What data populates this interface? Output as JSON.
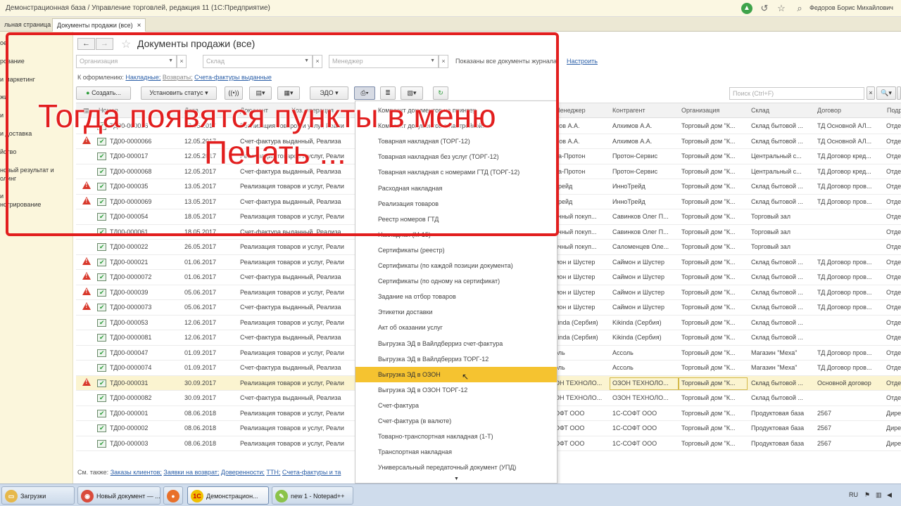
{
  "app": {
    "title": "Демонстрационная база / Управление торговлей, редакция 11  (1С:Предприятие)",
    "user": "Федоров Борис Михайлович"
  },
  "tabs": [
    {
      "label": "льная страница"
    },
    {
      "label": "Документы продажи (все)"
    }
  ],
  "sidebar": [
    "ое",
    "рование",
    "и маркетинг",
    "жи",
    "и",
    "и доставка",
    "йство",
    "новый результат и",
    "олинг",
    "и",
    "нстрирование"
  ],
  "form": {
    "title": "Документы продажи (все)",
    "filters": {
      "organization_placeholder": "Организация",
      "warehouse_placeholder": "Склад",
      "manager_placeholder": "Менеджер"
    },
    "shown_text": "Показаны все документы журнала",
    "setup_link": "Настроить",
    "to_form_label": "К оформлению:",
    "to_form_links": [
      "Накладные;",
      "Возвраты;",
      "Счета-фактуры выданные"
    ],
    "toolbar": {
      "create": "Создать...",
      "set_status": "Установить статус",
      "edo": "ЭДО"
    },
    "search_placeholder": "Поиск (Ctrl+F)"
  },
  "table": {
    "headers": [
      "Номер",
      "Дата",
      "Документ",
      "Хоз. операция",
      "Менеджер",
      "Контрагент",
      "Организация",
      "Склад",
      "Договор",
      "Подр"
    ],
    "rows": [
      {
        "warn": false,
        "num": "ТД00-000016",
        "date": "12.05.2017",
        "doc": "Реализация товаров и услуг, Реали",
        "mgr": "мов А.А.",
        "contr": "Алхимов А.А.",
        "org": "Торговый дом \"К...",
        "wh": "Склад бытовой ...",
        "contract": "ТД Основной АЛ...",
        "dep": "Отде"
      },
      {
        "warn": true,
        "num": "ТД00-0000066",
        "date": "12.05.2017",
        "doc": "Счет-фактура выданный, Реализа",
        "mgr": "мов А.А.",
        "contr": "Алхимов А.А.",
        "org": "Торговый дом \"К...",
        "wh": "Склад бытовой ...",
        "contract": "ТД Основной АЛ...",
        "dep": "Отде"
      },
      {
        "warn": false,
        "num": "ТД00-000017",
        "date": "12.05.2017",
        "doc": "Реализация товаров и услуг, Реали",
        "mgr": "ра-Протон",
        "contr": "Протон-Сервис",
        "org": "Торговый дом \"К...",
        "wh": "Центральный с...",
        "contract": "ТД Договор кред...",
        "dep": "Отде"
      },
      {
        "warn": false,
        "num": "ТД00-0000068",
        "date": "12.05.2017",
        "doc": "Счет-фактура выданный, Реализа",
        "mgr": "ра-Протон",
        "contr": "Протон-Сервис",
        "org": "Торговый дом \"К...",
        "wh": "Центральный с...",
        "contract": "ТД Договор кред...",
        "dep": "Отде"
      },
      {
        "warn": true,
        "num": "ТД00-000035",
        "date": "13.05.2017",
        "doc": "Реализация товаров и услуг, Реали",
        "mgr": "Трейд",
        "contr": "ИнноТрейд",
        "org": "Торговый дом \"К...",
        "wh": "Склад бытовой ...",
        "contract": "ТД Договор пров...",
        "dep": "Отде"
      },
      {
        "warn": true,
        "num": "ТД00-0000069",
        "date": "13.05.2017",
        "doc": "Счет-фактура выданный, Реализа",
        "mgr": "Трейд",
        "contr": "ИнноТрейд",
        "org": "Торговый дом \"К...",
        "wh": "Склад бытовой ...",
        "contract": "ТД Договор пров...",
        "dep": "Отде"
      },
      {
        "warn": false,
        "num": "ТД00-000054",
        "date": "18.05.2017",
        "doc": "Реализация товаров и услуг, Реали",
        "mgr": "ичный покуп...",
        "contr": "Савинков Олег П...",
        "org": "Торговый дом \"К...",
        "wh": "Торговый зал",
        "contract": "",
        "dep": "Отде"
      },
      {
        "warn": false,
        "num": "ТД00-000061",
        "date": "18.05.2017",
        "doc": "Счет-фактура выданный, Реализа",
        "mgr": "ичный покуп...",
        "contr": "Савинков Олег П...",
        "org": "Торговый дом \"К...",
        "wh": "Торговый зал",
        "contract": "",
        "dep": "Отде"
      },
      {
        "warn": false,
        "num": "ТД00-000022",
        "date": "26.05.2017",
        "doc": "Реализация товаров и услуг, Реали",
        "mgr": "ичный покуп...",
        "contr": "Саломенцев Оле...",
        "org": "Торговый дом \"К...",
        "wh": "Торговый зал",
        "contract": "",
        "dep": "Отде"
      },
      {
        "warn": true,
        "num": "ТД00-000021",
        "date": "01.06.2017",
        "doc": "Реализация товаров и услуг, Реали",
        "mgr": "мон и Шустер",
        "contr": "Саймон и Шустер",
        "org": "Торговый дом \"К...",
        "wh": "Склад бытовой ...",
        "contract": "ТД Договор пров...",
        "dep": "Отде"
      },
      {
        "warn": true,
        "num": "ТД00-0000072",
        "date": "01.06.2017",
        "doc": "Счет-фактура выданный, Реализа",
        "mgr": "мон и Шустер",
        "contr": "Саймон и Шустер",
        "org": "Торговый дом \"К...",
        "wh": "Склад бытовой ...",
        "contract": "ТД Договор пров...",
        "dep": "Отде"
      },
      {
        "warn": true,
        "num": "ТД00-000039",
        "date": "05.06.2017",
        "doc": "Реализация товаров и услуг, Реали",
        "mgr": "мон и Шустер",
        "contr": "Саймон и Шустер",
        "org": "Торговый дом \"К...",
        "wh": "Склад бытовой ...",
        "contract": "ТД Договор пров...",
        "dep": "Отде"
      },
      {
        "warn": true,
        "num": "ТД00-0000073",
        "date": "05.06.2017",
        "doc": "Счет-фактура выданный, Реализа",
        "mgr": "мон и Шустер",
        "contr": "Саймон и Шустер",
        "org": "Торговый дом \"К...",
        "wh": "Склад бытовой ...",
        "contract": "ТД Договор пров...",
        "dep": "Отде"
      },
      {
        "warn": false,
        "num": "ТД00-000053",
        "date": "12.06.2017",
        "doc": "Реализация товаров и услуг, Реали",
        "mgr": "kinda (Сербия)",
        "contr": "Kikinda (Сербия)",
        "org": "Торговый дом \"К...",
        "wh": "Склад бытовой ...",
        "contract": "",
        "dep": "Отде"
      },
      {
        "warn": false,
        "num": "ТД00-0000081",
        "date": "12.06.2017",
        "doc": "Счет-фактура выданный, Реализа",
        "mgr": "kinda (Сербия)",
        "contr": "Kikinda (Сербия)",
        "org": "Торговый дом \"К...",
        "wh": "Склад бытовой ...",
        "contract": "",
        "dep": "Отде"
      },
      {
        "warn": false,
        "num": "ТД00-000047",
        "date": "01.09.2017",
        "doc": "Реализация товаров и услуг, Реали",
        "mgr": "оль",
        "contr": "Ассоль",
        "org": "Торговый дом \"К...",
        "wh": "Магазин \"Меха\"",
        "contract": "ТД Договор пров...",
        "dep": "Отде"
      },
      {
        "warn": false,
        "num": "ТД00-0000074",
        "date": "01.09.2017",
        "doc": "Счет-фактура выданный, Реализа",
        "mgr": "оль",
        "contr": "Ассоль",
        "org": "Торговый дом \"К...",
        "wh": "Магазин \"Меха\"",
        "contract": "ТД Договор пров...",
        "dep": "Отде"
      },
      {
        "warn": true,
        "num": "ТД00-000031",
        "date": "30.09.2017",
        "doc": "Реализация товаров и услуг, Реали",
        "mgr": "ОН ТЕХНОЛО...",
        "contr": "ОЗОН ТЕХНОЛО...",
        "org": "Торговый дом \"К...",
        "wh": "Склад бытовой ...",
        "contract": "Основной договор",
        "dep": "Отде",
        "sel": true
      },
      {
        "warn": false,
        "num": "ТД00-0000082",
        "date": "30.09.2017",
        "doc": "Счет-фактура выданный, Реализа",
        "mgr": "ОН ТЕХНОЛО...",
        "contr": "ОЗОН ТЕХНОЛО...",
        "org": "Торговый дом \"К...",
        "wh": "Склад бытовой ...",
        "contract": "",
        "dep": "Отде"
      },
      {
        "warn": false,
        "num": "ТД00-000001",
        "date": "08.06.2018",
        "doc": "Реализация товаров и услуг, Реали",
        "mgr": "ОФТ ООО",
        "contr": "1С-СОФТ ООО",
        "org": "Торговый дом \"К...",
        "wh": "Продуктовая база",
        "contract": "2567",
        "dep": "Дире"
      },
      {
        "warn": false,
        "num": "ТД00-000002",
        "date": "08.06.2018",
        "doc": "Реализация товаров и услуг, Реали",
        "mgr": "ОФТ ООО",
        "contr": "1С-СОФТ ООО",
        "org": "Торговый дом \"К...",
        "wh": "Продуктовая база",
        "contract": "2567",
        "dep": "Дире"
      },
      {
        "warn": false,
        "num": "ТД00-000003",
        "date": "08.06.2018",
        "doc": "Реализация товаров и услуг, Реали",
        "mgr": "ОФТ ООО",
        "contr": "1С-СОФТ ООО",
        "org": "Торговый дом \"К...",
        "wh": "Продуктовая база",
        "contract": "2567",
        "dep": "Дире"
      }
    ]
  },
  "see_also": {
    "label": "См. также:",
    "links": [
      "Заказы клиентов;",
      "Заявки на возврат;",
      "Доверенности;",
      "ТТН;",
      "Счета-фактуры и та"
    ]
  },
  "print_menu": {
    "items": [
      "Комплект документов на принтер",
      "Комплект документов с настройкой...",
      "Товарная накладная (ТОРГ-12)",
      "Товарная накладная без услуг (ТОРГ-12)",
      "Товарная накладная с номерами ГТД (ТОРГ-12)",
      "Расходная накладная",
      "Реализация товаров",
      "Реестр номеров ГТД",
      "Накладная (М-15)",
      "Сертификаты (реестр)",
      "Сертификаты (по каждой позиции документа)",
      "Сертификаты (по одному на сертификат)",
      "Задание на отбор товаров",
      "Этикетки доставки",
      "Акт об оказании услуг",
      "Выгрузка ЭД в Вайлдберриз счет-фактура",
      "Выгрузка ЭД в Вайлдберриз ТОРГ-12",
      "Выгрузка ЭД в ОЗОН",
      "Выгрузка ЭД в ОЗОН ТОРГ-12",
      "Счет-фактура",
      "Счет-фактура (в валюте)",
      "Товарно-транспортная накладная (1-Т)",
      "Транспортная накладная",
      "Универсальный передаточный документ (УПД)"
    ],
    "highlighted_index": 17
  },
  "overlay": {
    "line1": "Тогда появятся пункты в меню",
    "line2": "Печать ..."
  },
  "taskbar": {
    "items": [
      "Загрузки",
      "Новый документ — ...",
      "",
      "Демонстрацион...",
      "new 1 - Notepad++"
    ],
    "lang": "RU"
  },
  "colors": {
    "overlay_red": "#e21e1e",
    "menu_highlight": "#f5c330",
    "link_blue": "#2b5fa8",
    "warning_red": "#d8382b"
  }
}
